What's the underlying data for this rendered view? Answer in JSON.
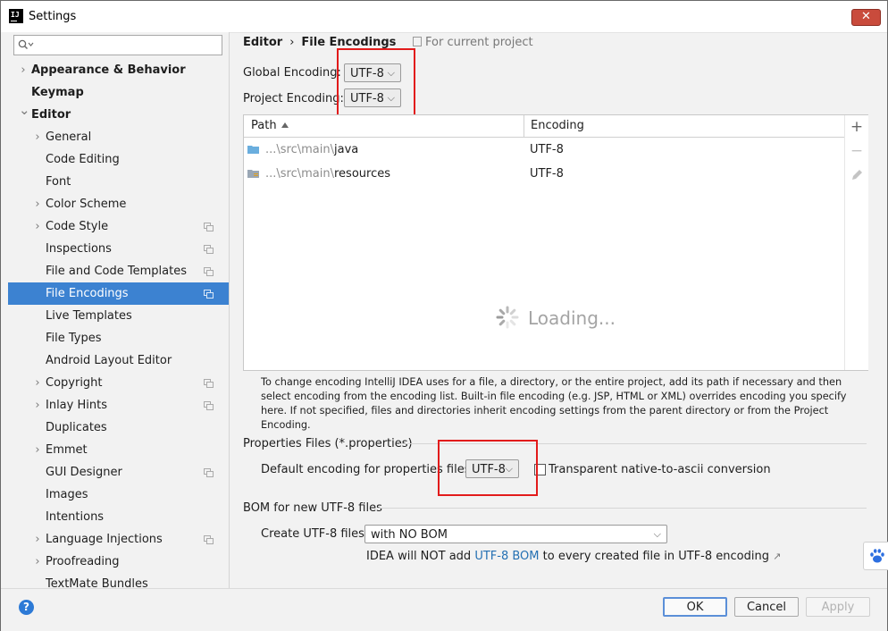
{
  "window": {
    "title": "Settings",
    "close_glyph": "✕",
    "app_icon_text": "IJ"
  },
  "sidebar": {
    "search": {
      "value": "",
      "placeholder": ""
    },
    "items": [
      {
        "label": "Appearance & Behavior",
        "level": 0,
        "expandable": true,
        "expanded": false,
        "bold": true,
        "copy_icon": false,
        "selected": false
      },
      {
        "label": "Keymap",
        "level": 0,
        "expandable": false,
        "expanded": false,
        "bold": true,
        "copy_icon": false,
        "selected": false
      },
      {
        "label": "Editor",
        "level": 0,
        "expandable": true,
        "expanded": true,
        "bold": true,
        "copy_icon": false,
        "selected": false
      },
      {
        "label": "General",
        "level": 1,
        "expandable": true,
        "expanded": false,
        "bold": false,
        "copy_icon": false,
        "selected": false
      },
      {
        "label": "Code Editing",
        "level": 1,
        "expandable": false,
        "expanded": false,
        "bold": false,
        "copy_icon": false,
        "selected": false
      },
      {
        "label": "Font",
        "level": 1,
        "expandable": false,
        "expanded": false,
        "bold": false,
        "copy_icon": false,
        "selected": false
      },
      {
        "label": "Color Scheme",
        "level": 1,
        "expandable": true,
        "expanded": false,
        "bold": false,
        "copy_icon": false,
        "selected": false
      },
      {
        "label": "Code Style",
        "level": 1,
        "expandable": true,
        "expanded": false,
        "bold": false,
        "copy_icon": true,
        "selected": false
      },
      {
        "label": "Inspections",
        "level": 1,
        "expandable": false,
        "expanded": false,
        "bold": false,
        "copy_icon": true,
        "selected": false
      },
      {
        "label": "File and Code Templates",
        "level": 1,
        "expandable": false,
        "expanded": false,
        "bold": false,
        "copy_icon": true,
        "selected": false
      },
      {
        "label": "File Encodings",
        "level": 1,
        "expandable": false,
        "expanded": false,
        "bold": false,
        "copy_icon": true,
        "selected": true
      },
      {
        "label": "Live Templates",
        "level": 1,
        "expandable": false,
        "expanded": false,
        "bold": false,
        "copy_icon": false,
        "selected": false
      },
      {
        "label": "File Types",
        "level": 1,
        "expandable": false,
        "expanded": false,
        "bold": false,
        "copy_icon": false,
        "selected": false
      },
      {
        "label": "Android Layout Editor",
        "level": 1,
        "expandable": false,
        "expanded": false,
        "bold": false,
        "copy_icon": false,
        "selected": false
      },
      {
        "label": "Copyright",
        "level": 1,
        "expandable": true,
        "expanded": false,
        "bold": false,
        "copy_icon": true,
        "selected": false
      },
      {
        "label": "Inlay Hints",
        "level": 1,
        "expandable": true,
        "expanded": false,
        "bold": false,
        "copy_icon": true,
        "selected": false
      },
      {
        "label": "Duplicates",
        "level": 1,
        "expandable": false,
        "expanded": false,
        "bold": false,
        "copy_icon": false,
        "selected": false
      },
      {
        "label": "Emmet",
        "level": 1,
        "expandable": true,
        "expanded": false,
        "bold": false,
        "copy_icon": false,
        "selected": false
      },
      {
        "label": "GUI Designer",
        "level": 1,
        "expandable": false,
        "expanded": false,
        "bold": false,
        "copy_icon": true,
        "selected": false
      },
      {
        "label": "Images",
        "level": 1,
        "expandable": false,
        "expanded": false,
        "bold": false,
        "copy_icon": false,
        "selected": false
      },
      {
        "label": "Intentions",
        "level": 1,
        "expandable": false,
        "expanded": false,
        "bold": false,
        "copy_icon": false,
        "selected": false
      },
      {
        "label": "Language Injections",
        "level": 1,
        "expandable": true,
        "expanded": false,
        "bold": false,
        "copy_icon": true,
        "selected": false
      },
      {
        "label": "Proofreading",
        "level": 1,
        "expandable": true,
        "expanded": false,
        "bold": false,
        "copy_icon": false,
        "selected": false
      },
      {
        "label": "TextMate Bundles",
        "level": 1,
        "expandable": false,
        "expanded": false,
        "bold": false,
        "copy_icon": false,
        "selected": false
      }
    ]
  },
  "breadcrumb": {
    "parent": "Editor",
    "separator": "›",
    "current": "File Encodings",
    "scope": "For current project"
  },
  "global_encoding": {
    "label": "Global Encoding:",
    "value": "UTF-8"
  },
  "project_encoding": {
    "label": "Project Encoding:",
    "value": "UTF-8"
  },
  "table": {
    "columns": [
      {
        "label": "Path",
        "sorted": "asc"
      },
      {
        "label": "Encoding"
      }
    ],
    "rows": [
      {
        "prefix": "...\\src\\main\\",
        "name": "java",
        "encoding": "UTF-8",
        "icon": "source-folder-icon"
      },
      {
        "prefix": "...\\src\\main\\",
        "name": "resources",
        "encoding": "UTF-8",
        "icon": "resources-folder-icon"
      }
    ],
    "loading_text": "Loading...",
    "tools": {
      "add": "+",
      "remove": "−"
    }
  },
  "description": "To change encoding IntelliJ IDEA uses for a file, a directory, or the entire project, add its path if necessary and then select encoding from the encoding list. Built-in file encoding (e.g. JSP, HTML or XML) overrides encoding you specify here. If not specified, files and directories inherit encoding settings from the parent directory or from the Project Encoding.",
  "properties": {
    "section_title": "Properties Files (*.properties)",
    "default_label": "Default encoding for properties files:",
    "default_value": "UTF-8",
    "native_label": "Transparent native-to-ascii conversion",
    "native_checked": false
  },
  "bom": {
    "section_title": "BOM for new UTF-8 files",
    "create_label": "Create UTF-8 files:",
    "create_value": "with NO BOM",
    "note_prefix": "IDEA will NOT add",
    "note_link": "UTF-8 BOM",
    "note_suffix": "to every created file in UTF-8 encoding",
    "note_arrow": "↗"
  },
  "buttons": {
    "ok": "OK",
    "cancel": "Cancel",
    "apply": "Apply",
    "apply_enabled": false,
    "help": "?"
  },
  "colors": {
    "selection": "#3c82d1",
    "highlight_box": "#e21b1b",
    "link": "#2470b3",
    "folder_blue": "#6aaede"
  }
}
